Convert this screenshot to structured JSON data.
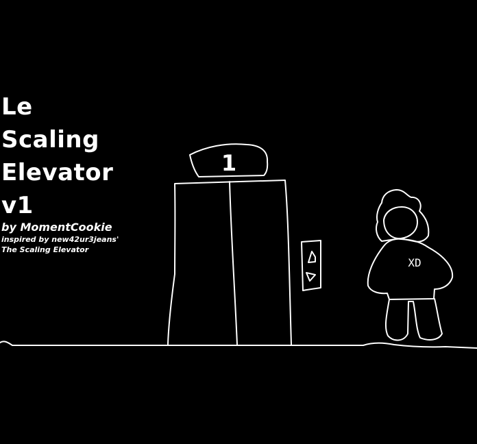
{
  "title": {
    "lines": [
      "Le",
      "Scaling",
      "Elevator",
      "v1"
    ],
    "byline": "by MomentCookie",
    "credit_line1": "inspired by new42ur3jeans'",
    "credit_line2": "The Scaling Elevator"
  },
  "elevator": {
    "floor_number": "1"
  },
  "character": {
    "shirt_text": "XD"
  },
  "colors": {
    "background": "#000000",
    "lines": "#ffffff"
  }
}
